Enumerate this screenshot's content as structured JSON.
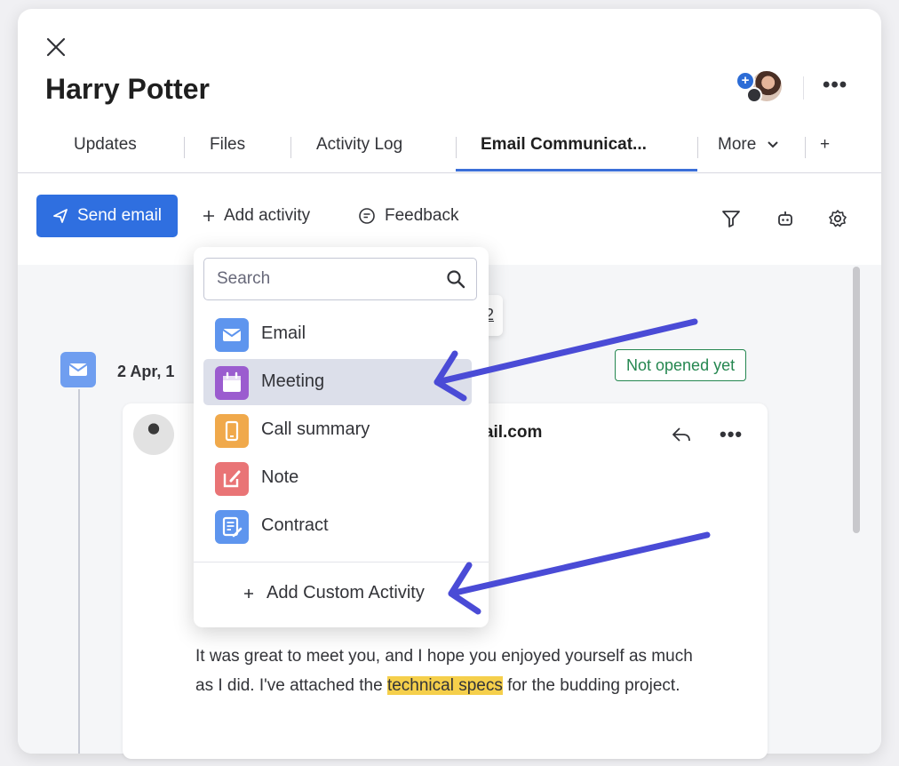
{
  "header": {
    "title": "Harry Potter",
    "close_icon": "close-icon",
    "more_icon": "more-horizontal-icon"
  },
  "tabs": [
    {
      "label": "Updates"
    },
    {
      "label": "Files"
    },
    {
      "label": "Activity Log"
    },
    {
      "label": "Email Communicat...",
      "active": true
    },
    {
      "label": "More"
    },
    {
      "label": "+"
    }
  ],
  "toolbar": {
    "send_email": "Send email",
    "add_activity": "Add activity",
    "feedback": "Feedback",
    "icons": [
      "filter-icon",
      "robot-icon",
      "gear-icon"
    ]
  },
  "activity_menu": {
    "search_placeholder": "Search",
    "items": [
      {
        "label": "Email",
        "icon": "email-icon",
        "color": "#5e95ee"
      },
      {
        "label": "Meeting",
        "icon": "calendar-icon",
        "color": "#9b5ccf"
      },
      {
        "label": "Call summary",
        "icon": "phone-icon",
        "color": "#f0a94b"
      },
      {
        "label": "Note",
        "icon": "note-icon",
        "color": "#e97476"
      },
      {
        "label": "Contract",
        "icon": "contract-icon",
        "color": "#5e95ee"
      }
    ],
    "add_custom": "Add Custom Activity"
  },
  "activity": {
    "date": "2 Apr, 1",
    "status": "Not opened yet",
    "chip_text": "2",
    "email": {
      "sender_fragment": "mail.com",
      "body_before": "It was great to meet you, and I hope you enjoyed yourself as much as I did. I've attached the ",
      "body_highlight": "technical specs",
      "body_after": " for the budding project."
    }
  },
  "colors": {
    "primary": "#2f6fe0",
    "tab_underline": "#3b6fd8",
    "status_green": "#258750",
    "highlight": "#f5cf4b",
    "annotation_arrow": "#4a4bd6"
  }
}
